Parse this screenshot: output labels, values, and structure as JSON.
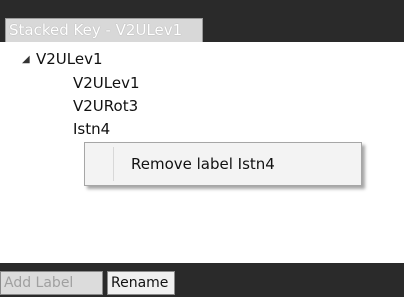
{
  "window": {
    "tab_title": "Stacked Key - V2ULev1"
  },
  "tree": {
    "root": {
      "label": "V2ULev1",
      "expanded": true
    },
    "children": [
      "V2ULev1",
      "V2URot3",
      "Istn4"
    ]
  },
  "context_menu": {
    "item_label": "Remove label Istn4"
  },
  "buttons": {
    "add_label": "Add Label",
    "rename": "Rename",
    "add_disabled": true
  }
}
